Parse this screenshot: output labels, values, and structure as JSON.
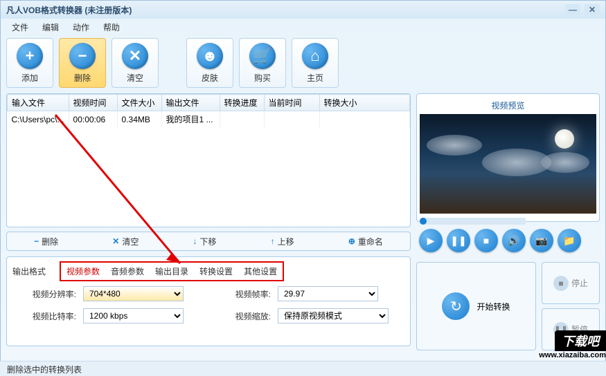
{
  "window": {
    "title": "凡人VOB格式转换器   (未注册版本)"
  },
  "menu": {
    "file": "文件",
    "edit": "编辑",
    "action": "动作",
    "help": "帮助"
  },
  "toolbar": {
    "add": "添加",
    "delete": "删除",
    "clear": "清空",
    "skin": "皮肤",
    "buy": "购买",
    "home": "主页"
  },
  "table": {
    "headers": {
      "input": "输入文件",
      "vtime": "视频时间",
      "fsize": "文件大小",
      "output": "输出文件",
      "progress": "转换进度",
      "curtime": "当前时间",
      "csize": "转换大小"
    },
    "rows": [
      {
        "input": "C:\\Users\\pc\\...",
        "vtime": "00:00:06",
        "fsize": "0.34MB",
        "output": "我的项目1 ...",
        "progress": "",
        "curtime": "",
        "csize": ""
      }
    ]
  },
  "actions": {
    "delete": "删除",
    "clear": "清空",
    "movedown": "下移",
    "moveup": "上移",
    "rename": "重命名"
  },
  "settings": {
    "label": "输出格式",
    "tabs": {
      "video": "视频参数",
      "audio": "音频参数",
      "outdir": "输出目录",
      "convset": "转换设置",
      "other": "其他设置"
    },
    "fields": {
      "resolution_label": "视频分辨率:",
      "resolution_value": "704*480",
      "framerate_label": "视频帧率:",
      "framerate_value": "29.97",
      "bitrate_label": "视频比特率:",
      "bitrate_value": "1200 kbps",
      "scale_label": "视频缩放:",
      "scale_value": "保持原视频模式"
    }
  },
  "preview": {
    "title": "视频预览"
  },
  "convert": {
    "start": "开始转换",
    "stop": "停止",
    "pause": "暂停"
  },
  "status": "删除选中的转换列表",
  "watermark": {
    "brand": "下载吧",
    "url": "www.xiazaiba.com"
  }
}
